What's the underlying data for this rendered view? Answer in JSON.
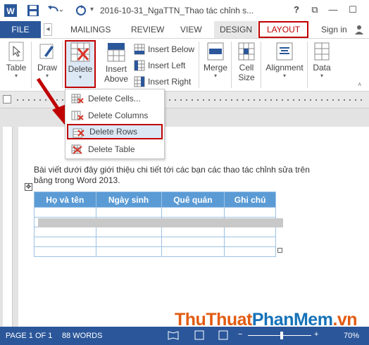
{
  "titlebar": {
    "title": "2016-10-31_NgaTTN_Thao tác chỉnh s...",
    "help": "?",
    "restore": "⧉",
    "minimize": "—",
    "maximize": "☐"
  },
  "tabs": {
    "file": "FILE",
    "mailings": "MAILINGS",
    "review": "REVIEW",
    "view": "VIEW",
    "design": "DESIGN",
    "layout": "LAYOUT",
    "signin": "Sign in"
  },
  "ribbon": {
    "table": "Table",
    "draw": "Draw",
    "delete": "Delete",
    "insert_above_1": "Insert",
    "insert_above_2": "Above",
    "insert_below": "Insert Below",
    "insert_left": "Insert Left",
    "insert_right": "Insert Right",
    "merge": "Merge",
    "cell_size_1": "Cell",
    "cell_size_2": "Size",
    "alignment": "Alignment",
    "data": "Data"
  },
  "dropdown": [
    "Delete Cells...",
    "Delete Columns",
    "Delete Rows",
    "Delete Table"
  ],
  "document": {
    "paragraph": "Bài viết dưới đây giới thiệu chi tiết tới các bạn các thao tác chỉnh sửa trên bảng trong Word 2013.",
    "headers": [
      "Họ và tên",
      "Ngày sinh",
      "Quê quán",
      "Ghi chú"
    ]
  },
  "status": {
    "page": "PAGE 1 OF 1",
    "words": "88 WORDS",
    "zoom": "70%"
  },
  "watermark": {
    "part1": "ThuThuat",
    "part2": "PhanMem",
    "part3": ".vn"
  },
  "colors": {
    "accent": "#2b579a",
    "highlight": "#c00000",
    "table_header": "#5b9bd5"
  }
}
